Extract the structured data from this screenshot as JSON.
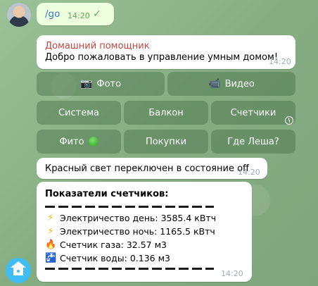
{
  "outgoing": {
    "command": "/go",
    "time": "14:20",
    "status_icon": "check-icon"
  },
  "greeting": {
    "sender": "Домашний помощник",
    "text": "Добро пожаловать в управление умным домом!",
    "time": "14:20"
  },
  "keyboard": {
    "row1": [
      {
        "label": "Фото",
        "icon": "camera-icon",
        "glyph": "📷"
      },
      {
        "label": "Видео",
        "icon": "video-camera-icon",
        "glyph": "📹"
      }
    ],
    "row2": [
      {
        "label": "Система"
      },
      {
        "label": "Балкон"
      },
      {
        "label": "Счетчики"
      }
    ],
    "row3": [
      {
        "label": "Фито",
        "icon": "green-circle-icon"
      },
      {
        "label": "Покупки"
      },
      {
        "label": "Где Леша?"
      }
    ]
  },
  "notice": {
    "text": "Красный свет переключен в состояние off",
    "time": "14:20"
  },
  "meters": {
    "title": "Показатели счетчиков:",
    "lines": [
      {
        "icon": "lightning-icon",
        "glyph": "⚡",
        "text": "Электричество день: 3585.4 кВтч"
      },
      {
        "icon": "lightning-icon",
        "glyph": "⚡",
        "text": "Электричество ночь: 1165.5 кВтч"
      },
      {
        "icon": "fire-icon",
        "glyph": "🔥",
        "text": "Счетчик газа:  32.57 м3"
      },
      {
        "icon": "faucet-icon",
        "glyph": "🚰",
        "text": "Счетчик воды:  0.136 м3"
      }
    ],
    "time": "14:20"
  },
  "colors": {
    "sender": "#c4473d",
    "link": "#3a79c3",
    "outgoing_bg": "#eeffde",
    "bot_avatar": "#41bdf5"
  }
}
